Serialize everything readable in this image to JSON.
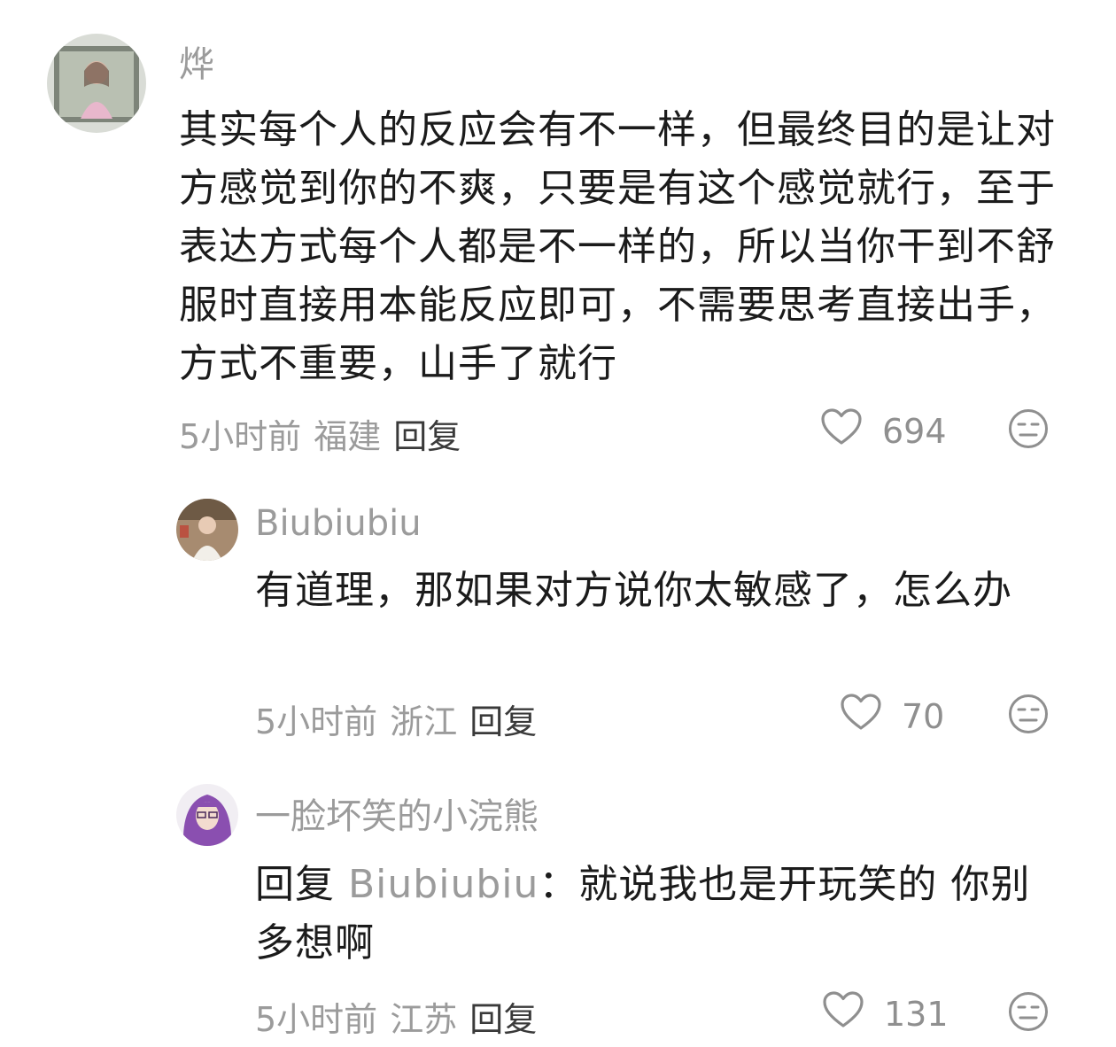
{
  "comments": [
    {
      "username": "烨",
      "text": "其实每个人的反应会有不一样，但最终目的是让对方感觉到你的不爽，只要是有这个感觉就行，至于表达方式每个人都是不一样的，所以当你干到不舒服时直接用本能反应即可，不需要思考直接出手，方式不重要，山手了就行",
      "time": "5小时前",
      "location": "福建",
      "reply_label": "回复",
      "likes": "694"
    },
    {
      "username": "Biubiubiu",
      "text": "有道理，那如果对方说你太敏感了，怎么办",
      "time": "5小时前",
      "location": "浙江",
      "reply_label": "回复",
      "likes": "70"
    },
    {
      "username": "一脸坏笑的小浣熊",
      "reply_prefix": "回复",
      "reply_to": "Biubiubiu",
      "reply_colon": "：",
      "text": "就说我也是开玩笑的 你别多想啊",
      "time": "5小时前",
      "location": "江苏",
      "reply_label": "回复",
      "likes": "131"
    }
  ],
  "icons": {
    "like": "heart-outline-icon",
    "dislike": "neutral-face-icon"
  },
  "colors": {
    "text": "#1b1b1b",
    "secondary": "#9b9b9b",
    "icon": "#8f8f8f"
  }
}
